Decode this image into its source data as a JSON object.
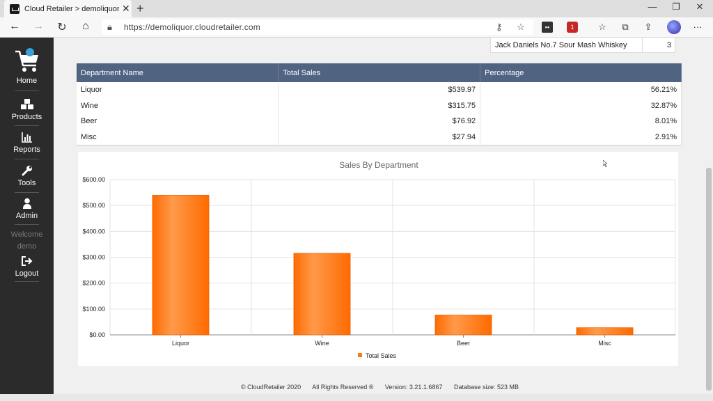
{
  "browser": {
    "tab_title": "Cloud Retailer > demoliquor > H",
    "tab_close": "✕",
    "new_tab": "+",
    "url": "https://demoliquor.cloudretailer.com",
    "win_minimize": "—",
    "win_restore": "❐",
    "win_close": "✕",
    "more_menu": "···",
    "ext_badge": "1"
  },
  "sidebar": {
    "items": [
      {
        "label": "Home"
      },
      {
        "label": "Products"
      },
      {
        "label": "Reports"
      },
      {
        "label": "Tools"
      },
      {
        "label": "Admin"
      }
    ],
    "welcome": "Welcome",
    "user": "demo",
    "logout": "Logout"
  },
  "top_item": {
    "name": "Jack Daniels No.7 Sour Mash Whiskey",
    "qty": "3"
  },
  "dept_table": {
    "headers": [
      "Department Name",
      "Total Sales",
      "Percentage"
    ],
    "rows": [
      {
        "name": "Liquor",
        "sales": "$539.97",
        "pct": "56.21%"
      },
      {
        "name": "Wine",
        "sales": "$315.75",
        "pct": "32.87%"
      },
      {
        "name": "Beer",
        "sales": "$76.92",
        "pct": "8.01%"
      },
      {
        "name": "Misc",
        "sales": "$27.94",
        "pct": "2.91%"
      }
    ]
  },
  "chart_data": {
    "type": "bar",
    "title": "Sales By Department",
    "categories": [
      "Liquor",
      "Wine",
      "Beer",
      "Misc"
    ],
    "series": [
      {
        "name": "Total Sales",
        "values": [
          539.97,
          315.75,
          76.92,
          27.94
        ],
        "color": "#ff7518"
      }
    ],
    "ylim": [
      0,
      600
    ],
    "yticks": [
      "$0.00",
      "$100.00",
      "$200.00",
      "$300.00",
      "$400.00",
      "$500.00",
      "$600.00"
    ],
    "grid": true,
    "legend": "bottom"
  },
  "footer": {
    "copyright": "© CloudRetailer 2020",
    "rights": "All Rights Reserved ®",
    "version": "Version: 3.21.1.6867",
    "dbsize": "Database size: 523 MB"
  },
  "colors": {
    "sidebar": "#2b2b2b",
    "table_header": "#506482",
    "bar": "#ff7518"
  }
}
